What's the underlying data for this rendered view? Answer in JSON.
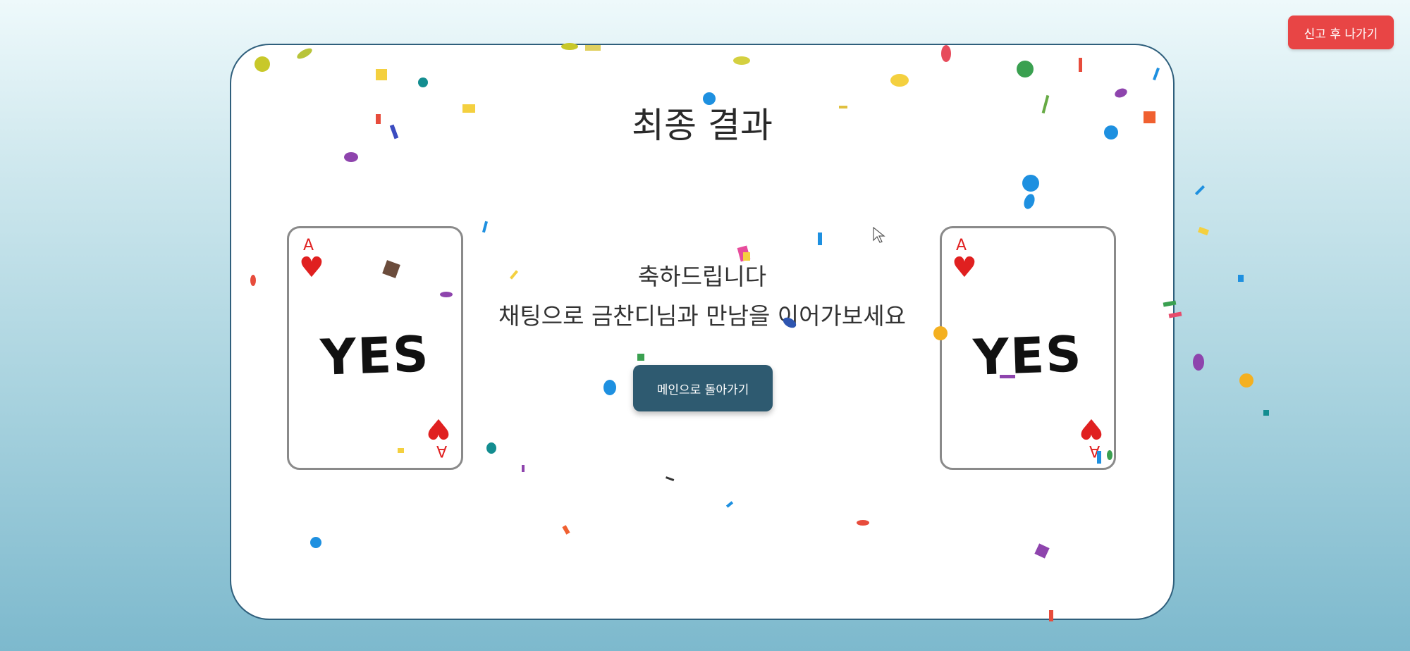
{
  "header": {
    "report_exit_label": "신고 후 나가기"
  },
  "result": {
    "title": "최종 결과",
    "message_line1": "축하드립니다",
    "message_line2": "채팅으로 금찬디님과 만남을 이어가보세요",
    "main_button_label": "메인으로 돌아가기"
  },
  "cards": {
    "left": {
      "rank": "A",
      "suit": "♥",
      "word": "YES"
    },
    "right": {
      "rank": "A",
      "suit": "♥",
      "word": "YES"
    }
  },
  "colors": {
    "report_button": "#e84545",
    "main_button": "#2e5a70",
    "suit": "#e02020",
    "panel_border": "#2f5f7c"
  }
}
